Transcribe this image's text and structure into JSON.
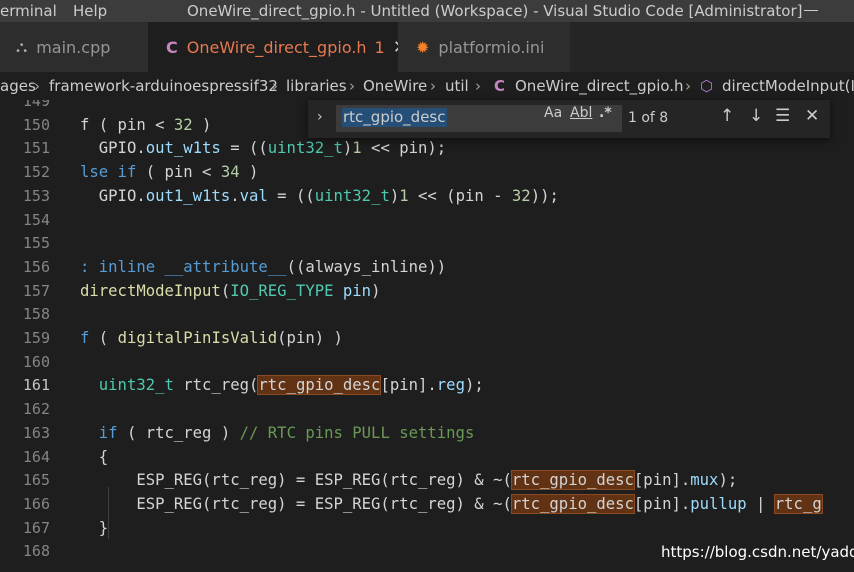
{
  "titlebar": {
    "menu": [
      "erminal",
      "Help"
    ],
    "title": "OneWire_direct_gpio.h - Untitled (Workspace) - Visual Studio Code [Administrator]"
  },
  "tabs": [
    {
      "icon": "⛬",
      "label": "main.cpp",
      "active": false
    },
    {
      "icon": "C",
      "label": "OneWire_direct_gpio.h",
      "modified": "1",
      "close": "✕",
      "active": true
    },
    {
      "icon": "✹",
      "label": "platformio.ini",
      "active": false
    }
  ],
  "breadcrumb": {
    "items": [
      "ages",
      "framework-arduinoespressif32",
      "libraries",
      "OneWire",
      "util",
      "OneWire_direct_gpio.h",
      "directModeInput(IO"
    ],
    "separator": "›",
    "file_icon": "C",
    "symbol_icon": "⬡"
  },
  "find_widget": {
    "query": "rtc_gpio_desc",
    "match_case": "Aa",
    "whole_word": "Abl",
    "regex": ".*",
    "count": "1 of 8",
    "prev": "↑",
    "next": "↓",
    "selection": "☰",
    "close": "✕",
    "toggle": "›"
  },
  "editor": {
    "line_numbers": [
      "149",
      "150",
      "151",
      "152",
      "153",
      "154",
      "155",
      "156",
      "157",
      "158",
      "159",
      "160",
      "161",
      "162",
      "163",
      "164",
      "165",
      "166",
      "167",
      "168"
    ],
    "current_line": "161",
    "lines": [
      {
        "t": [
          [
            "",
            ""
          ]
        ]
      },
      {
        "t": [
          [
            "",
            "f ( pin < "
          ],
          [
            "nm",
            "32"
          ],
          [
            "",
            " )"
          ]
        ]
      },
      {
        "t": [
          [
            "",
            "  GPIO."
          ],
          [
            "pr",
            "out_w1ts"
          ],
          [
            "",
            " = (("
          ],
          [
            "ty",
            "uint32_t"
          ],
          [
            "",
            ")"
          ],
          [
            "nm",
            "1"
          ],
          [
            "",
            " << pin);"
          ]
        ]
      },
      {
        "t": [
          [
            "kw",
            "lse if"
          ],
          [
            "",
            " ( pin < "
          ],
          [
            "nm",
            "34"
          ],
          [
            "",
            " )"
          ]
        ]
      },
      {
        "t": [
          [
            "",
            "  GPIO."
          ],
          [
            "pr",
            "out1_w1ts"
          ],
          [
            "",
            "."
          ],
          [
            "pr",
            "val"
          ],
          [
            "",
            " = (("
          ],
          [
            "ty",
            "uint32_t"
          ],
          [
            "",
            ")"
          ],
          [
            "nm",
            "1"
          ],
          [
            "",
            " << (pin - "
          ],
          [
            "nm",
            "32"
          ],
          [
            "",
            "));"
          ]
        ]
      },
      {
        "t": [
          [
            "",
            ""
          ]
        ]
      },
      {
        "t": [
          [
            "",
            ""
          ]
        ]
      },
      {
        "t": [
          [
            "kw",
            ": inline"
          ],
          [
            "",
            " "
          ],
          [
            "kw",
            "__attribute__"
          ],
          [
            "",
            "((always_inline))"
          ]
        ]
      },
      {
        "t": [
          [
            "fn",
            "directModeInput"
          ],
          [
            "",
            "("
          ],
          [
            "ty",
            "IO_REG_TYPE"
          ],
          [
            "",
            " "
          ],
          [
            "pm",
            "pin"
          ],
          [
            "",
            ")"
          ]
        ]
      },
      {
        "t": [
          [
            "",
            ""
          ]
        ]
      },
      {
        "t": [
          [
            "kw",
            "f"
          ],
          [
            "",
            " ( "
          ],
          [
            "fn",
            "digitalPinIsValid"
          ],
          [
            "",
            "(pin) )"
          ]
        ]
      },
      {
        "t": [
          [
            "",
            ""
          ]
        ]
      },
      {
        "t": [
          [
            "",
            "  "
          ],
          [
            "ty",
            "uint32_t"
          ],
          [
            "",
            " rtc_reg("
          ],
          [
            "hl",
            "rtc_gpio_desc"
          ],
          [
            "",
            "[pin]."
          ],
          [
            "pr",
            "reg"
          ],
          [
            "",
            ");"
          ]
        ]
      },
      {
        "t": [
          [
            "",
            ""
          ]
        ]
      },
      {
        "t": [
          [
            "",
            "  "
          ],
          [
            "kw",
            "if"
          ],
          [
            "",
            " ( rtc_reg ) "
          ],
          [
            "cm",
            "// RTC pins PULL settings"
          ]
        ]
      },
      {
        "t": [
          [
            "",
            "  {"
          ]
        ]
      },
      {
        "t": [
          [
            "",
            "      ESP_REG(rtc_reg) = ESP_REG(rtc_reg) & ~("
          ],
          [
            "hl",
            "rtc_gpio_desc"
          ],
          [
            "",
            "[pin]."
          ],
          [
            "pr",
            "mux"
          ],
          [
            "",
            ");"
          ]
        ]
      },
      {
        "t": [
          [
            "",
            "      ESP_REG(rtc_reg) = ESP_REG(rtc_reg) & ~("
          ],
          [
            "hl",
            "rtc_gpio_desc"
          ],
          [
            "",
            "[pin]."
          ],
          [
            "pr",
            "pullup"
          ],
          [
            "",
            " | "
          ],
          [
            "hl",
            "rtc_g"
          ]
        ]
      },
      {
        "t": [
          [
            "",
            "  }"
          ]
        ]
      },
      {
        "t": [
          [
            "",
            ""
          ]
        ]
      }
    ]
  },
  "watermark": "https://blog.csdn.net/yaddi",
  "colors": {
    "background": "#1e1e1e",
    "tab_active_text": "#e7784f",
    "find_highlight": "#613214",
    "current_match": "#264f78"
  }
}
